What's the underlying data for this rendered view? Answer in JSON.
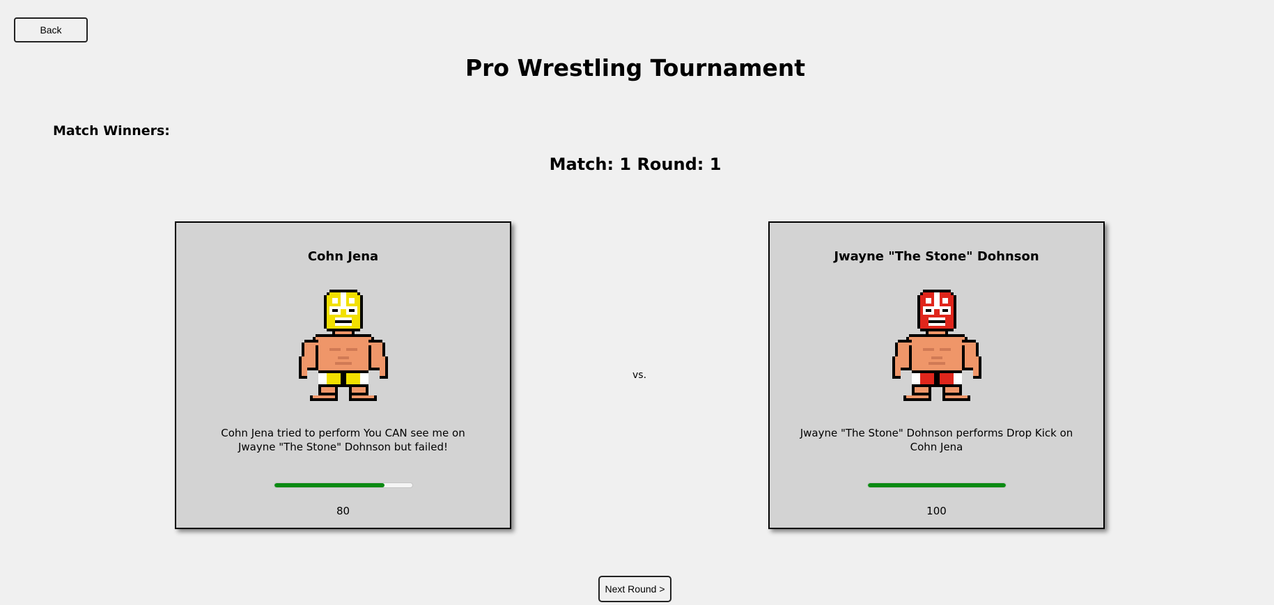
{
  "nav": {
    "back_label": "Back"
  },
  "title": "Pro Wrestling Tournament",
  "match_winners_label": "Match Winners:",
  "match_info": "Match: 1 Round: 1",
  "vs_label": "vs.",
  "wrestlers": [
    {
      "name": "Cohn Jena",
      "message": "Cohn Jena tried to perform You CAN see me on Jwayne \"The Stone\" Dohnson but failed!",
      "health": "80",
      "health_fraction": 0.8,
      "mask_color": "#f2e000",
      "mask_accent": "#ffffff",
      "trunks_color": "#f2e000"
    },
    {
      "name": "Jwayne \"The Stone\" Dohnson",
      "message": "Jwayne \"The Stone\" Dohnson performs Drop Kick on Cohn Jena",
      "health": "100",
      "health_fraction": 1.0,
      "mask_color": "#e0261c",
      "mask_accent": "#ffffff",
      "trunks_color": "#e0261c"
    }
  ],
  "next_round_label": "Next Round >",
  "colors": {
    "background": "#f0f0f0",
    "card": "#d3d3d3",
    "health": "#0a8a12",
    "skin": "#ef9669"
  }
}
